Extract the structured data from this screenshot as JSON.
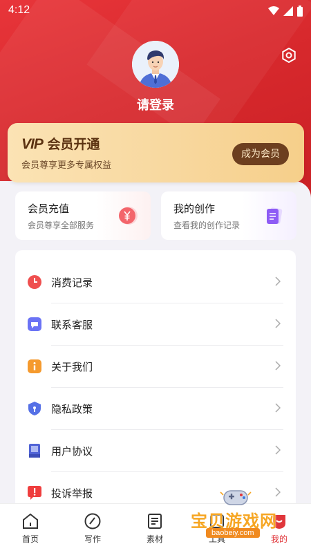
{
  "status_bar": {
    "time": "4:12"
  },
  "profile": {
    "login_label": "请登录"
  },
  "vip_card": {
    "vip_word": "VIP",
    "title": "会员开通",
    "subtitle": "会员尊享更多专属权益",
    "button_label": "成为会员"
  },
  "quick_cards": [
    {
      "title": "会员充值",
      "subtitle": "会员尊享全部服务",
      "icon": "yen-coin-icon"
    },
    {
      "title": "我的创作",
      "subtitle": "查看我的创作记录",
      "icon": "document-icon"
    }
  ],
  "menu": [
    {
      "label": "消费记录",
      "icon": "clock-icon",
      "color": "#ef4f4f"
    },
    {
      "label": "联系客服",
      "icon": "chat-icon",
      "color": "#6b73f5"
    },
    {
      "label": "关于我们",
      "icon": "info-icon",
      "color": "#f59a2e"
    },
    {
      "label": "隐私政策",
      "icon": "shield-icon",
      "color": "#5570e6"
    },
    {
      "label": "用户协议",
      "icon": "book-icon",
      "color": "#5164d6"
    },
    {
      "label": "投诉举报",
      "icon": "alert-icon",
      "color": "#ef3e3e"
    }
  ],
  "tabs": [
    {
      "label": "首页",
      "icon": "home-icon"
    },
    {
      "label": "写作",
      "icon": "compass-icon"
    },
    {
      "label": "素材",
      "icon": "material-icon"
    },
    {
      "label": "工具",
      "icon": "tools-icon"
    },
    {
      "label": "我的",
      "icon": "me-icon",
      "active": true
    }
  ],
  "watermark": {
    "text": "宝贝游戏网",
    "url": "baobeiy.com"
  },
  "colors": {
    "brand_red": "#d8292d",
    "vip_gold": "#f8d89f",
    "vip_brown": "#6d3f1f"
  }
}
